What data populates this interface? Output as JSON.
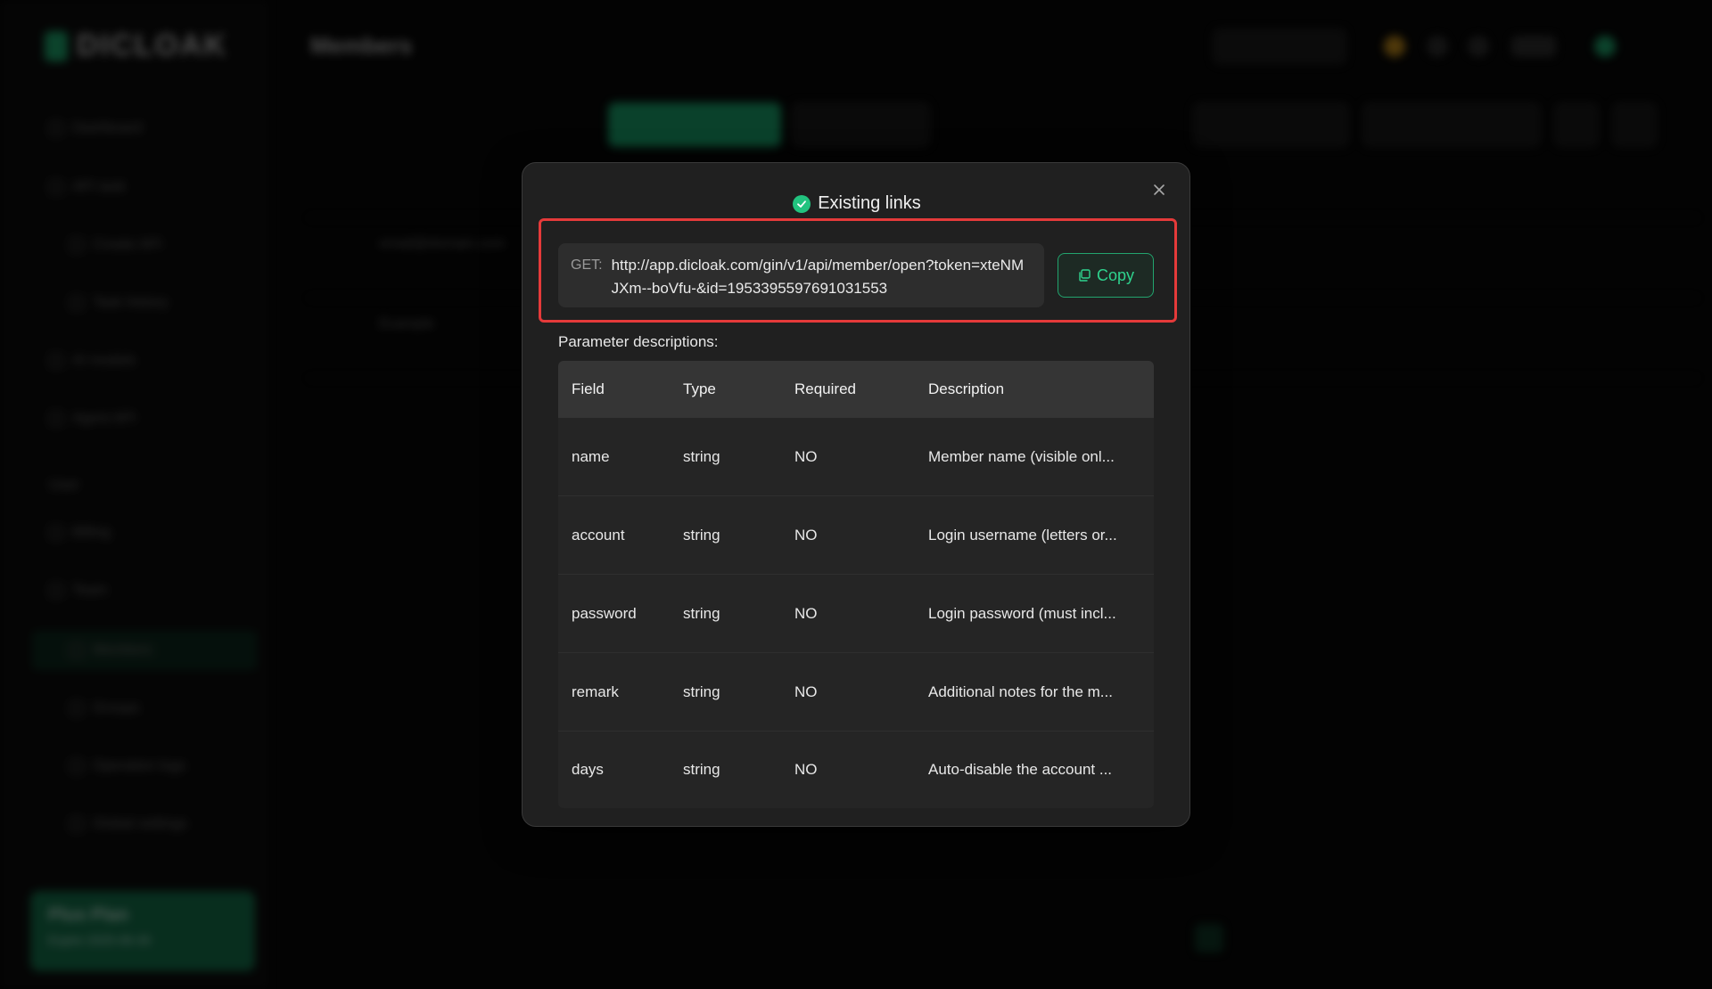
{
  "background": {
    "logo_text": "DICLOAK",
    "page_title": "Members",
    "sidebar_items": [
      "Dashboard",
      "API task",
      "Create API",
      "Task history",
      "AI models",
      "Agent API",
      "User",
      "Billing",
      "Team",
      "Members",
      "Groups",
      "Operation logs",
      "Global settings"
    ],
    "plan_title": "Plus Plan",
    "plan_sub": "Expire 2025-06-30",
    "row1_name": "email@domain.com",
    "row2_name": "Example"
  },
  "modal": {
    "title": "Existing links",
    "link": {
      "method_label": "GET:",
      "url": "http://app.dicloak.com/gin/v1/api/member/open?token=xteNMJXm--boVfu-&id=1953395597691031553"
    },
    "copy_label": "Copy",
    "param_heading": "Parameter descriptions:",
    "table": {
      "headers": [
        "Field",
        "Type",
        "Required",
        "Description"
      ],
      "rows": [
        [
          "name",
          "string",
          "NO",
          "Member name (visible onl..."
        ],
        [
          "account",
          "string",
          "NO",
          "Login username (letters or..."
        ],
        [
          "password",
          "string",
          "NO",
          "Login password (must incl..."
        ],
        [
          "remark",
          "string",
          "NO",
          "Additional notes for the m..."
        ],
        [
          "days",
          "string",
          "NO",
          "Auto-disable the account ..."
        ]
      ]
    }
  },
  "colors": {
    "accent": "#22c37f",
    "highlight": "#e53a3a",
    "modal_bg": "#202020"
  }
}
